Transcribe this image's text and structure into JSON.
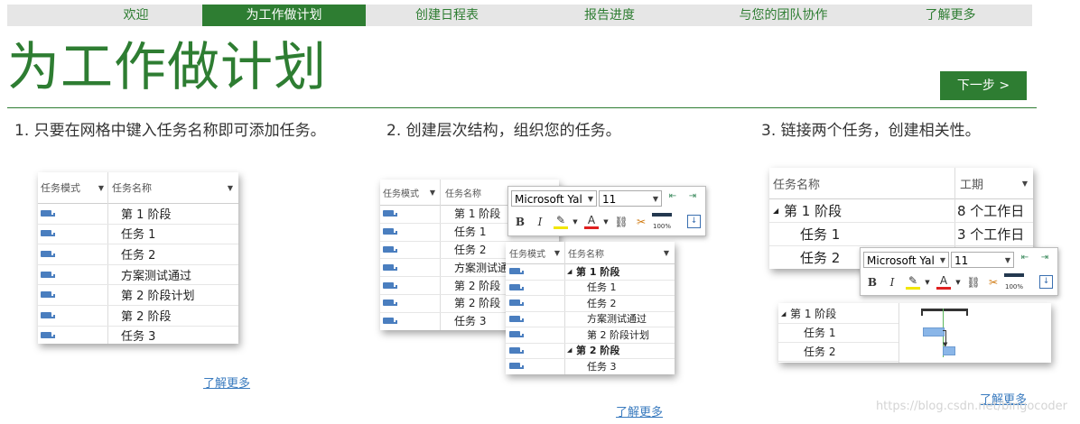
{
  "nav": {
    "items": [
      {
        "label": "欢迎",
        "active": false
      },
      {
        "label": "为工作做计划",
        "active": true
      },
      {
        "label": "创建日程表",
        "active": false
      },
      {
        "label": "报告进度",
        "active": false
      },
      {
        "label": "与您的团队协作",
        "active": false
      },
      {
        "label": "了解更多",
        "active": false
      }
    ]
  },
  "page": {
    "title": "为工作做计划",
    "next_label": "下一步 >"
  },
  "colors": {
    "brand_green": "#2e7d32",
    "nav_bg": "#e6e6e6",
    "link_blue": "#3a7bbf",
    "task_icon_blue": "#4a7ebf",
    "gantt_bar": "#8ab6e8"
  },
  "steps": [
    {
      "text": "1. 只要在网格中键入任务名称即可添加任务。",
      "learn_more": "了解更多"
    },
    {
      "text": "2. 创建层次结构，组织您的任务。",
      "learn_more": "了解更多"
    },
    {
      "text": "3. 链接两个任务，创建相关性。",
      "learn_more": "了解更多"
    }
  ],
  "grid1": {
    "headers": [
      "任务模式",
      "任务名称"
    ],
    "rows": [
      "第 1 阶段",
      "任务 1",
      "任务 2",
      "方案测试通过",
      "第 2 阶段计划",
      "第 2 阶段",
      "任务 3"
    ]
  },
  "grid2_back": {
    "headers": [
      "任务模式",
      "任务名称"
    ],
    "rows": [
      "第 1 阶段",
      "任务 1",
      "任务 2",
      "方案测试通",
      "第 2 阶段",
      "第 2 阶段",
      "任务 3"
    ]
  },
  "grid2_front": {
    "headers": [
      "任务模式",
      "任务名称"
    ],
    "rows": [
      {
        "name": "第 1 阶段",
        "summary": true
      },
      {
        "name": "任务 1",
        "summary": false
      },
      {
        "name": "任务 2",
        "summary": false
      },
      {
        "name": "方案测试通过",
        "summary": false
      },
      {
        "name": "第 2 阶段计划",
        "summary": false
      },
      {
        "name": "第 2 阶段",
        "summary": true
      },
      {
        "name": "任务 3",
        "summary": false
      }
    ]
  },
  "toolbar": {
    "font": "Microsoft Yal",
    "size": "11",
    "bold": "B",
    "italic": "I",
    "font_color": "A",
    "percent": "100%"
  },
  "grid3": {
    "headers": [
      "任务名称",
      "工期"
    ],
    "rows": [
      {
        "name": "第 1 阶段",
        "duration": "8 个工作日",
        "summary": true
      },
      {
        "name": "任务 1",
        "duration": "3 个工作日",
        "summary": false
      },
      {
        "name": "任务 2",
        "duration": "",
        "summary": false
      }
    ]
  },
  "grid3_gantt": {
    "rows": [
      {
        "name": "第 1 阶段",
        "summary": true
      },
      {
        "name": "任务 1",
        "summary": false
      },
      {
        "name": "任务 2",
        "summary": false
      }
    ]
  },
  "watermark": "https://blog.csdn.net/bingocoder"
}
